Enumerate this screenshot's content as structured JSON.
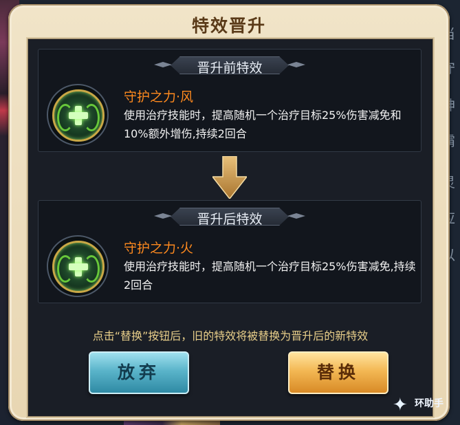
{
  "dialog": {
    "title": "特效晋升",
    "before": {
      "banner": "晋升前特效",
      "name": "守护之力·风",
      "desc": "使用治疗技能时，提高随机一个治疗目标25%伤害减免和10%额外增伤,持续2回合"
    },
    "after": {
      "banner": "晋升后特效",
      "name": "守护之力·火",
      "desc": "使用治疗技能时，提高随机一个治疗目标25%伤害减免,持续2回合"
    },
    "notice": "点击“替换”按钮后，旧的特效将被替换为晋升后的新特效",
    "buttons": {
      "abandon": "放弃",
      "replace": "替换"
    }
  },
  "background": {
    "right_chars": [
      "当",
      "守",
      "神",
      "霸",
      "灵",
      "应",
      "以"
    ]
  },
  "watermark": {
    "text": "环助手",
    "icon": "star-logo-icon"
  },
  "colors": {
    "frame": "#f1e4c8",
    "effect_name": "#ff8a1e",
    "notice": "#e9cf8a",
    "abandon_button": "#5ab4ca",
    "replace_button": "#f3b854"
  }
}
